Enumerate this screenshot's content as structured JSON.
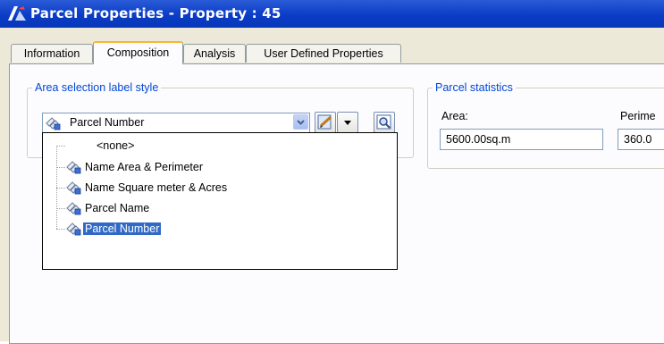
{
  "window": {
    "title": "Parcel Properties - Property : 45",
    "app_icon": "autocad-icon"
  },
  "tabs": [
    {
      "label": "Information",
      "active": false
    },
    {
      "label": "Composition",
      "active": true
    },
    {
      "label": "Analysis",
      "active": false
    },
    {
      "label": "User Defined Properties",
      "active": false
    }
  ],
  "area_selection": {
    "legend": "Area selection label style",
    "selected_value": "Parcel Number",
    "buttons": [
      "edit-style-icon",
      "dropdown-arrow-icon",
      "preview-icon"
    ],
    "options": [
      {
        "label": "<none>",
        "has_icon": false,
        "selected": false
      },
      {
        "label": "Name Area & Perimeter",
        "has_icon": true,
        "selected": false
      },
      {
        "label": "Name Square meter & Acres",
        "has_icon": true,
        "selected": false
      },
      {
        "label": "Parcel Name",
        "has_icon": true,
        "selected": false
      },
      {
        "label": "Parcel Number",
        "has_icon": true,
        "selected": true
      }
    ]
  },
  "parcel_statistics": {
    "legend": "Parcel statistics",
    "area_label": "Area:",
    "area_value": "5600.00sq.m",
    "perimeter_label": "Perime",
    "perimeter_value": "360.0"
  },
  "colors": {
    "title_bar": "#0a3cc6",
    "selection": "#316ac5",
    "legend_text": "#0046d5",
    "dialog_bg": "#ece9d8"
  }
}
